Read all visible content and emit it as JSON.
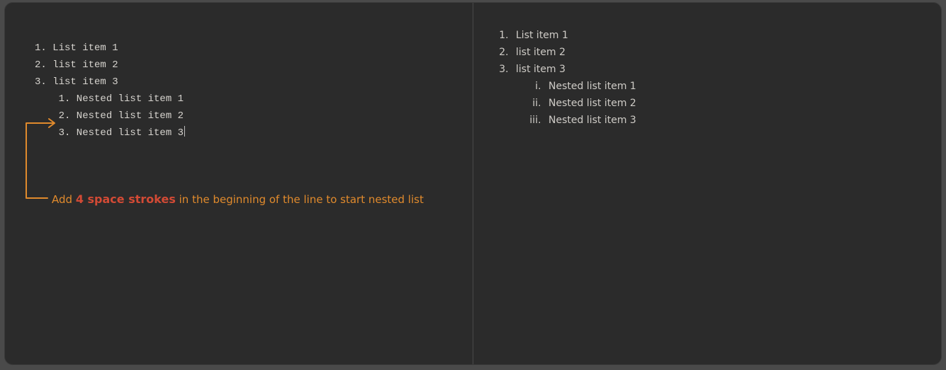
{
  "source": {
    "lines": [
      "1. List item 1",
      "2. list item 2",
      "3. list item 3",
      "    1. Nested list item 1",
      "    2. Nested list item 2",
      "    3. Nested list item 3"
    ]
  },
  "annotation": {
    "prefix": "Add ",
    "bold": "4 space strokes",
    "suffix": " in the beginning of the line to start nested list"
  },
  "rendered": {
    "items": [
      "List item 1",
      "list item 2",
      "list item 3"
    ],
    "nested": [
      "Nested list item 1",
      "Nested list item 2",
      "Nested list item 3"
    ]
  }
}
